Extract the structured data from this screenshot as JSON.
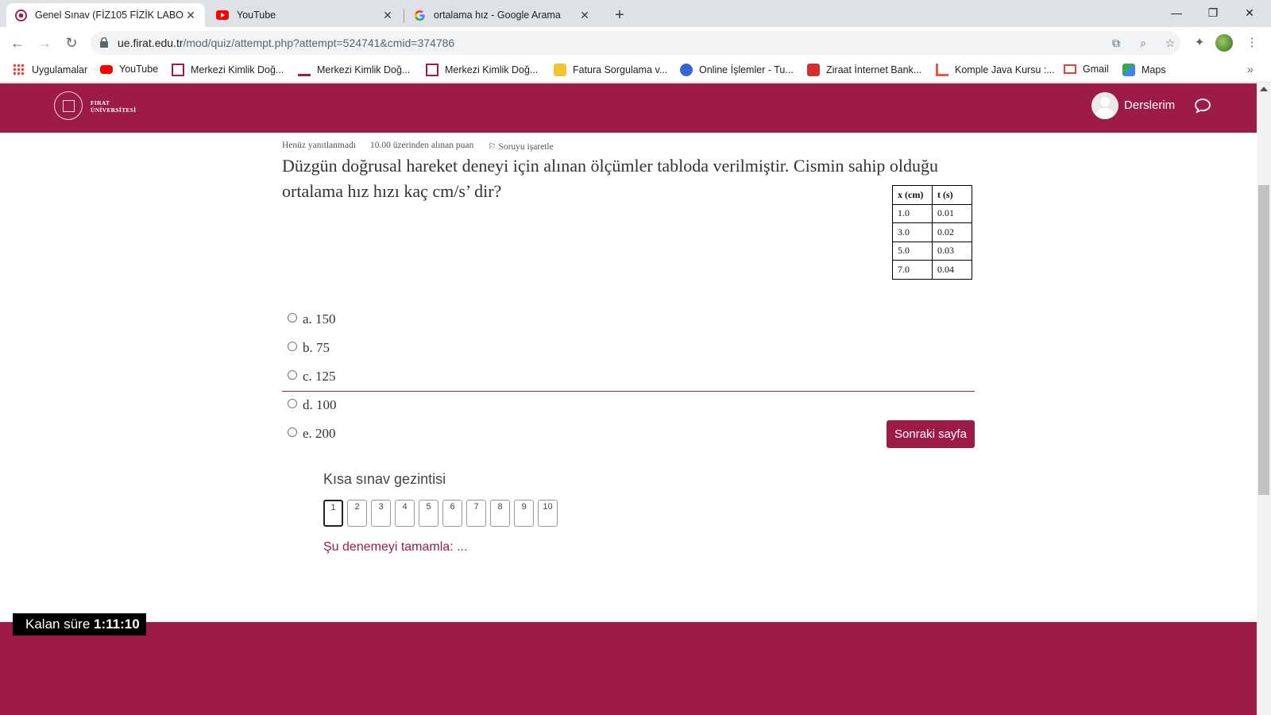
{
  "browser": {
    "tabs": [
      {
        "title": "Genel Sınav (FİZ105 FİZİK LABOR",
        "active": true
      },
      {
        "title": "YouTube",
        "active": false
      },
      {
        "title": "ortalama hız - Google Arama",
        "active": false
      }
    ],
    "url_host": "ue.firat.edu.tr",
    "url_path": "/mod/quiz/attempt.php?attempt=524741&cmid=374786",
    "bookmarks": [
      "Uygulamalar",
      "YouTube",
      "Merkezi Kimlik Doğ...",
      "Merkezi Kimlik Doğ...",
      "Merkezi Kimlik Doğ...",
      "Fatura Sorgulama v...",
      "Online İşlemler - Tu...",
      "Ziraat İnternet Bank...",
      "Komple Java Kursu :...",
      "Gmail",
      "Maps"
    ]
  },
  "site": {
    "logo_line1": "FIRAT",
    "logo_line2": "ÜNİVERSİTESİ",
    "user_menu": "Derslerim",
    "brand_color": "#9c1c47"
  },
  "question": {
    "status": "Henüz yanıtlanmadı",
    "points": "10.00 üzerinden alınan puan",
    "flag": "Soruyu işaretle",
    "text": "Düzgün doğrusal hareket deneyi için alınan ölçümler tabloda verilmiştir. Cismin sahip olduğu ortalama hız hızı kaç cm/s’ dir?",
    "table": {
      "headers": [
        "x (cm)",
        "t (s)"
      ],
      "rows": [
        [
          "1.0",
          "0.01"
        ],
        [
          "3.0",
          "0.02"
        ],
        [
          "5.0",
          "0.03"
        ],
        [
          "7.0",
          "0.04"
        ]
      ]
    },
    "answers": [
      "a. 150",
      "b. 75",
      "c. 125",
      "d. 100",
      "e. 200"
    ]
  },
  "actions": {
    "next": "Sonraki sayfa"
  },
  "quiz_nav": {
    "title": "Kısa sınav gezintisi",
    "buttons": [
      "1",
      "2",
      "3",
      "4",
      "5",
      "6",
      "7",
      "8",
      "9",
      "10"
    ],
    "current": "1",
    "finish": "Şu denemeyi tamamla: ..."
  },
  "timer": {
    "label": "Kalan süre",
    "value": "1:11:10"
  }
}
